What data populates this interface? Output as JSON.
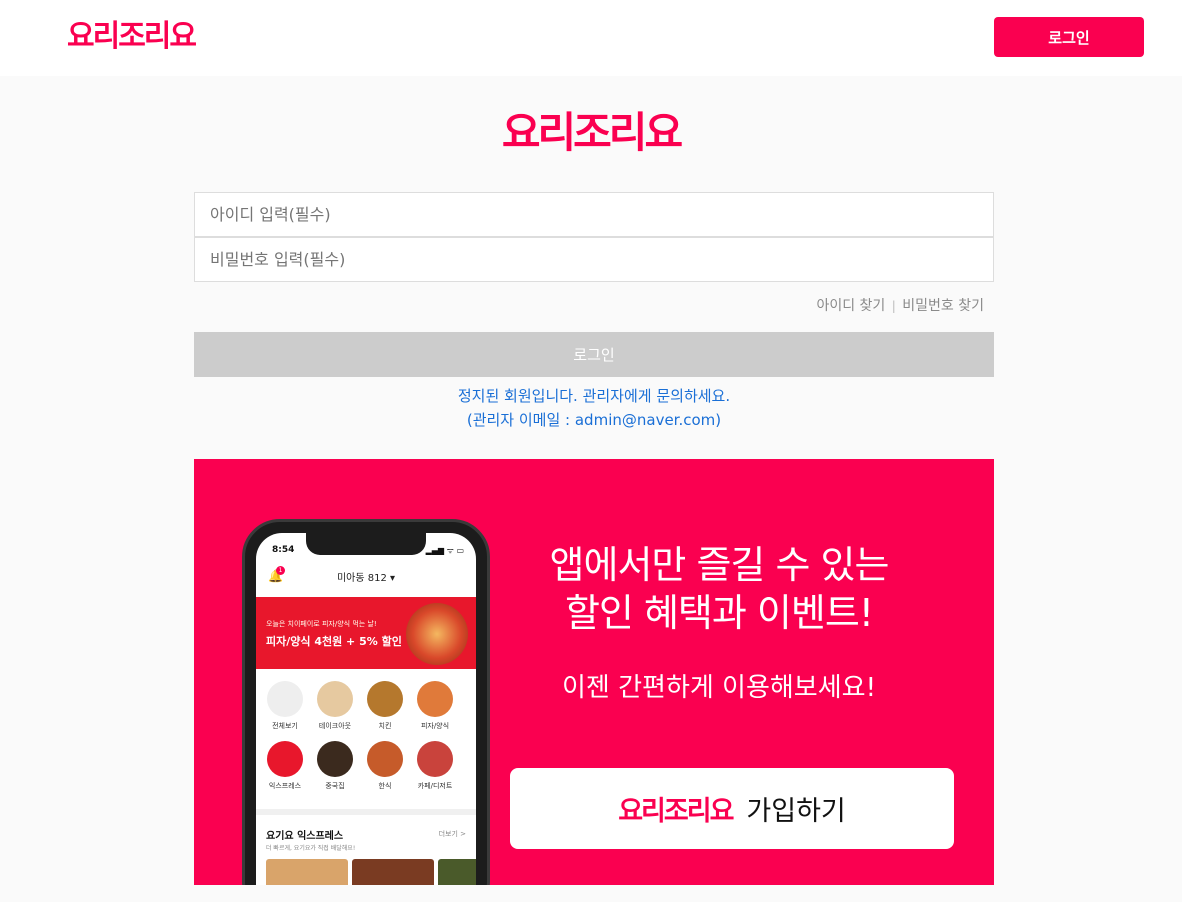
{
  "header": {
    "logo_text": "요리조리요",
    "login_label": "로그인"
  },
  "login_form": {
    "logo_text": "요리조리요",
    "id_placeholder": "아이디 입력(필수)",
    "pw_placeholder": "비밀번호 입력(필수)",
    "find_id_label": "아이디 찾기",
    "separator": "|",
    "find_pw_label": "비밀번호 찾기",
    "submit_label": "로그인",
    "error_line1": "정지된 회원입니다. 관리자에게 문의하세요.",
    "error_line2": "(관리자 이메일 : admin@naver.com)"
  },
  "banner": {
    "headline_line1": "앱에서만 즐길 수 있는",
    "headline_line2": "할인 혜택과 이벤트!",
    "subline": "이젠 간편하게 이용해보세요!",
    "signup_logo": "요리조리요",
    "signup_label": "가입하기",
    "background_color": "#fa0050",
    "phone": {
      "time": "8:54",
      "status_icons": "▂▄▆ ᯤ ▭",
      "bell_badge": "1",
      "location": "미아동 812 ▾",
      "promo_sub": "오늘은 치이페이로 피자/양식 먹는 날!",
      "promo_main": "피자/양식 4천원 + 5% 할인",
      "categories": [
        {
          "label": "전체보기",
          "color": "#eeeeee"
        },
        {
          "label": "테이크아웃",
          "color": "#e6c9a0"
        },
        {
          "label": "치킨",
          "color": "#b5782d"
        },
        {
          "label": "피자/양식",
          "color": "#e07a3a"
        },
        {
          "label": "익스프레스",
          "color": "#e8172c"
        },
        {
          "label": "중국집",
          "color": "#3b2a1e"
        },
        {
          "label": "한식",
          "color": "#c65b2a"
        },
        {
          "label": "카페/디저트",
          "color": "#c9433c"
        }
      ],
      "section_title": "요기요 익스프레스",
      "section_sub": "더 빠르게, 요기요가 직접 배달해요!",
      "section_more": "더보기 >"
    }
  }
}
